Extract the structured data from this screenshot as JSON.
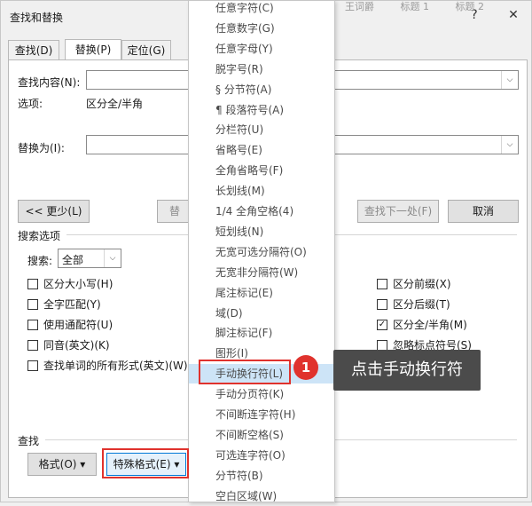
{
  "dialog": {
    "title": "查找和替换",
    "help_label": "?",
    "close_label": "✕",
    "bg_text": [
      "王词爵",
      "标题 1",
      "标题 2"
    ]
  },
  "tabs": [
    {
      "label": "查找(D)",
      "active": false
    },
    {
      "label": "替换(P)",
      "active": true
    },
    {
      "label": "定位(G)",
      "active": false
    }
  ],
  "find": {
    "label": "查找内容(N):",
    "value": ""
  },
  "options": {
    "label": "选项:",
    "value": "区分全/半角"
  },
  "replace": {
    "label": "替换为(I):",
    "value": ""
  },
  "buttons": {
    "less": "<< 更少(L)",
    "replace_partial": "替",
    "find_next": "查找下一处(F)",
    "cancel": "取消"
  },
  "search_options": {
    "title": "搜索选项",
    "search_label": "搜索:",
    "search_value": "全部"
  },
  "checkboxes_left": [
    {
      "label": "区分大小写(H)",
      "checked": false
    },
    {
      "label": "全字匹配(Y)",
      "checked": false
    },
    {
      "label": "使用通配符(U)",
      "checked": false
    },
    {
      "label": "同音(英文)(K)",
      "checked": false
    },
    {
      "label": "查找单词的所有形式(英文)(W)",
      "checked": false
    }
  ],
  "checkboxes_right": [
    {
      "label": "区分前缀(X)",
      "checked": false
    },
    {
      "label": "区分后缀(T)",
      "checked": false
    },
    {
      "label": "区分全/半角(M)",
      "checked": true
    },
    {
      "label": "忽略标点符号(S)",
      "checked": false
    }
  ],
  "footer": {
    "section_title": "查找",
    "format_button": "格式(O) ▾",
    "special_button": "特殊格式(E) ▾"
  },
  "menu_items": [
    {
      "label": "任意字符(C)",
      "highlighted": false
    },
    {
      "label": "任意数字(G)",
      "highlighted": false
    },
    {
      "label": "任意字母(Y)",
      "highlighted": false
    },
    {
      "label": "脱字号(R)",
      "highlighted": false
    },
    {
      "label": "§ 分节符(A)",
      "highlighted": false
    },
    {
      "label": "¶ 段落符号(A)",
      "highlighted": false
    },
    {
      "label": "分栏符(U)",
      "highlighted": false
    },
    {
      "label": "省略号(E)",
      "highlighted": false
    },
    {
      "label": "全角省略号(F)",
      "highlighted": false
    },
    {
      "label": "长划线(M)",
      "highlighted": false
    },
    {
      "label": "1/4 全角空格(4)",
      "highlighted": false
    },
    {
      "label": "短划线(N)",
      "highlighted": false
    },
    {
      "label": "无宽可选分隔符(O)",
      "highlighted": false
    },
    {
      "label": "无宽非分隔符(W)",
      "highlighted": false
    },
    {
      "label": "尾注标记(E)",
      "highlighted": false
    },
    {
      "label": "域(D)",
      "highlighted": false
    },
    {
      "label": "脚注标记(F)",
      "highlighted": false
    },
    {
      "label": "图形(I)",
      "highlighted": false
    },
    {
      "label": "手动换行符(L)",
      "highlighted": true
    },
    {
      "label": "手动分页符(K)",
      "highlighted": false
    },
    {
      "label": "不间断连字符(H)",
      "highlighted": false
    },
    {
      "label": "不间断空格(S)",
      "highlighted": false
    },
    {
      "label": "可选连字符(O)",
      "highlighted": false
    },
    {
      "label": "分节符(B)",
      "highlighted": false
    },
    {
      "label": "空白区域(W)",
      "highlighted": false
    }
  ],
  "annotation": {
    "step": "1",
    "text": "点击手动换行符",
    "color": "#e0322d"
  }
}
